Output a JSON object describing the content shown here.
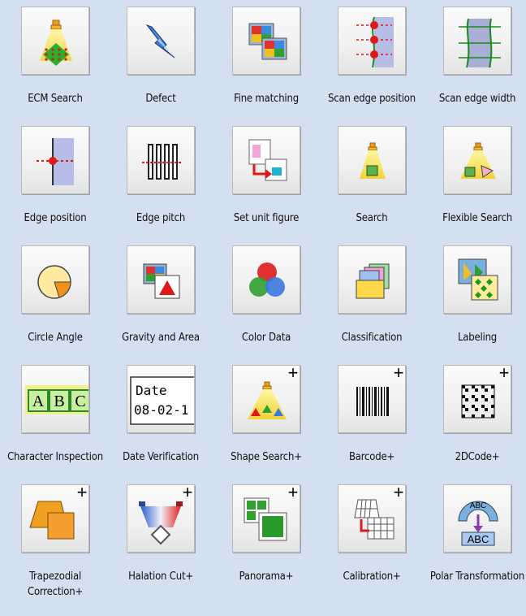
{
  "tools": [
    {
      "label": "ECM Search",
      "icon": "ecm-search-icon"
    },
    {
      "label": "Defect",
      "icon": "defect-icon"
    },
    {
      "label": "Fine matching",
      "icon": "fine-matching-icon"
    },
    {
      "label": "Scan edge position",
      "icon": "scan-edge-position-icon"
    },
    {
      "label": "Scan edge width",
      "icon": "scan-edge-width-icon"
    },
    {
      "label": "Edge position",
      "icon": "edge-position-icon"
    },
    {
      "label": "Edge pitch",
      "icon": "edge-pitch-icon"
    },
    {
      "label": "Set unit figure",
      "icon": "set-unit-figure-icon"
    },
    {
      "label": "Search",
      "icon": "search-icon"
    },
    {
      "label": "Flexible Search",
      "icon": "flexible-search-icon"
    },
    {
      "label": "Circle Angle",
      "icon": "circle-angle-icon"
    },
    {
      "label": "Gravity and Area",
      "icon": "gravity-and-area-icon"
    },
    {
      "label": "Color Data",
      "icon": "color-data-icon"
    },
    {
      "label": "Classification",
      "icon": "classification-icon"
    },
    {
      "label": "Labeling",
      "icon": "labeling-icon"
    },
    {
      "label": "Character Inspection",
      "icon": "character-inspection-icon",
      "glyph_text": "AB"
    },
    {
      "label": "Date Verification",
      "icon": "date-verification-icon",
      "glyph_text": [
        "Date",
        "08-02-1"
      ]
    },
    {
      "label": "Shape Search+",
      "icon": "shape-search-icon"
    },
    {
      "label": "Barcode+",
      "icon": "barcode-icon"
    },
    {
      "label": "2DCode+",
      "icon": "2dcode-icon"
    },
    {
      "label": "Trapezodial Correction+",
      "icon": "trapezoidal-correction-icon"
    },
    {
      "label": "Halation Cut+",
      "icon": "halation-cut-icon"
    },
    {
      "label": "Panorama+",
      "icon": "panorama-icon"
    },
    {
      "label": "Calibration+",
      "icon": "calibration-icon"
    },
    {
      "label": "Polar Transformation",
      "icon": "polar-transformation-icon",
      "glyph_text": "ABC"
    }
  ],
  "plus_badge": "+",
  "colors": {
    "background": "#d4dff0",
    "accent_red": "#e02020",
    "accent_green": "#2a9a2a",
    "accent_yellow": "#f5c400"
  }
}
